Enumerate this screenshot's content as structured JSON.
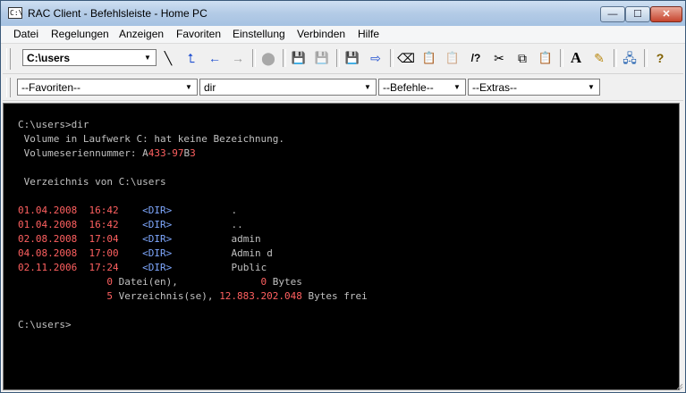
{
  "window": {
    "title": "RAC Client - Befehlsleiste - Home PC",
    "app_icon_text": "C:\\",
    "minimize_glyph": "—",
    "maximize_glyph": "☐",
    "close_glyph": "✕"
  },
  "menu": [
    "Datei",
    "Regelungen",
    "Anzeigen",
    "Favoriten",
    "Einstellung",
    "Verbinden",
    "Hilfe"
  ],
  "toolbar": {
    "path_value": "C:\\users",
    "tools": {
      "up_dir": "╲",
      "parent": "⮤",
      "back": "←",
      "forward": "→",
      "stop": "⬤",
      "save": "💾",
      "save_disabled": "💾",
      "save2": "💾",
      "export": "⇨",
      "erase": "⌫",
      "paste_copy": "📋",
      "paste_copy2": "📋",
      "help_cmd": "/?",
      "cut": "✂",
      "copy": "⧉",
      "paste": "📋",
      "font": "A",
      "highlight": "✎",
      "network": "🖧",
      "help": "?"
    }
  },
  "toolbar2": {
    "favorites": "--Favoriten--",
    "command": "dir",
    "befehle": "--Befehle--",
    "extras": "--Extras--"
  },
  "console": {
    "prompt1": "C:\\users>dir",
    "volume_line": " Volume in Laufwerk C: hat keine Bezeichnung.",
    "serial_label": " Volumeseriennummer: ",
    "serial": {
      "a": "A",
      "b": "433",
      "c": "-",
      "d": "97",
      "e": "B",
      "f": "3"
    },
    "dir_of": " Verzeichnis von C:\\users",
    "entries": [
      {
        "date": "01.04.2008",
        "time": "16:42",
        "type": "<DIR>",
        "name": "."
      },
      {
        "date": "01.04.2008",
        "time": "16:42",
        "type": "<DIR>",
        "name": ".."
      },
      {
        "date": "02.08.2008",
        "time": "17:04",
        "type": "<DIR>",
        "name": "admin"
      },
      {
        "date": "04.08.2008",
        "time": "17:00",
        "type": "<DIR>",
        "name": "Admin d"
      },
      {
        "date": "02.11.2006",
        "time": "17:24",
        "type": "<DIR>",
        "name": "Public"
      }
    ],
    "files_count": "0",
    "files_label": " Datei(en),",
    "files_bytes": "0",
    "bytes_label": " Bytes",
    "dirs_count": "5",
    "dirs_label": " Verzeichnis(se), ",
    "free_bytes": "12.883.202.048",
    "free_label": " Bytes frei",
    "prompt2": "C:\\users>"
  }
}
